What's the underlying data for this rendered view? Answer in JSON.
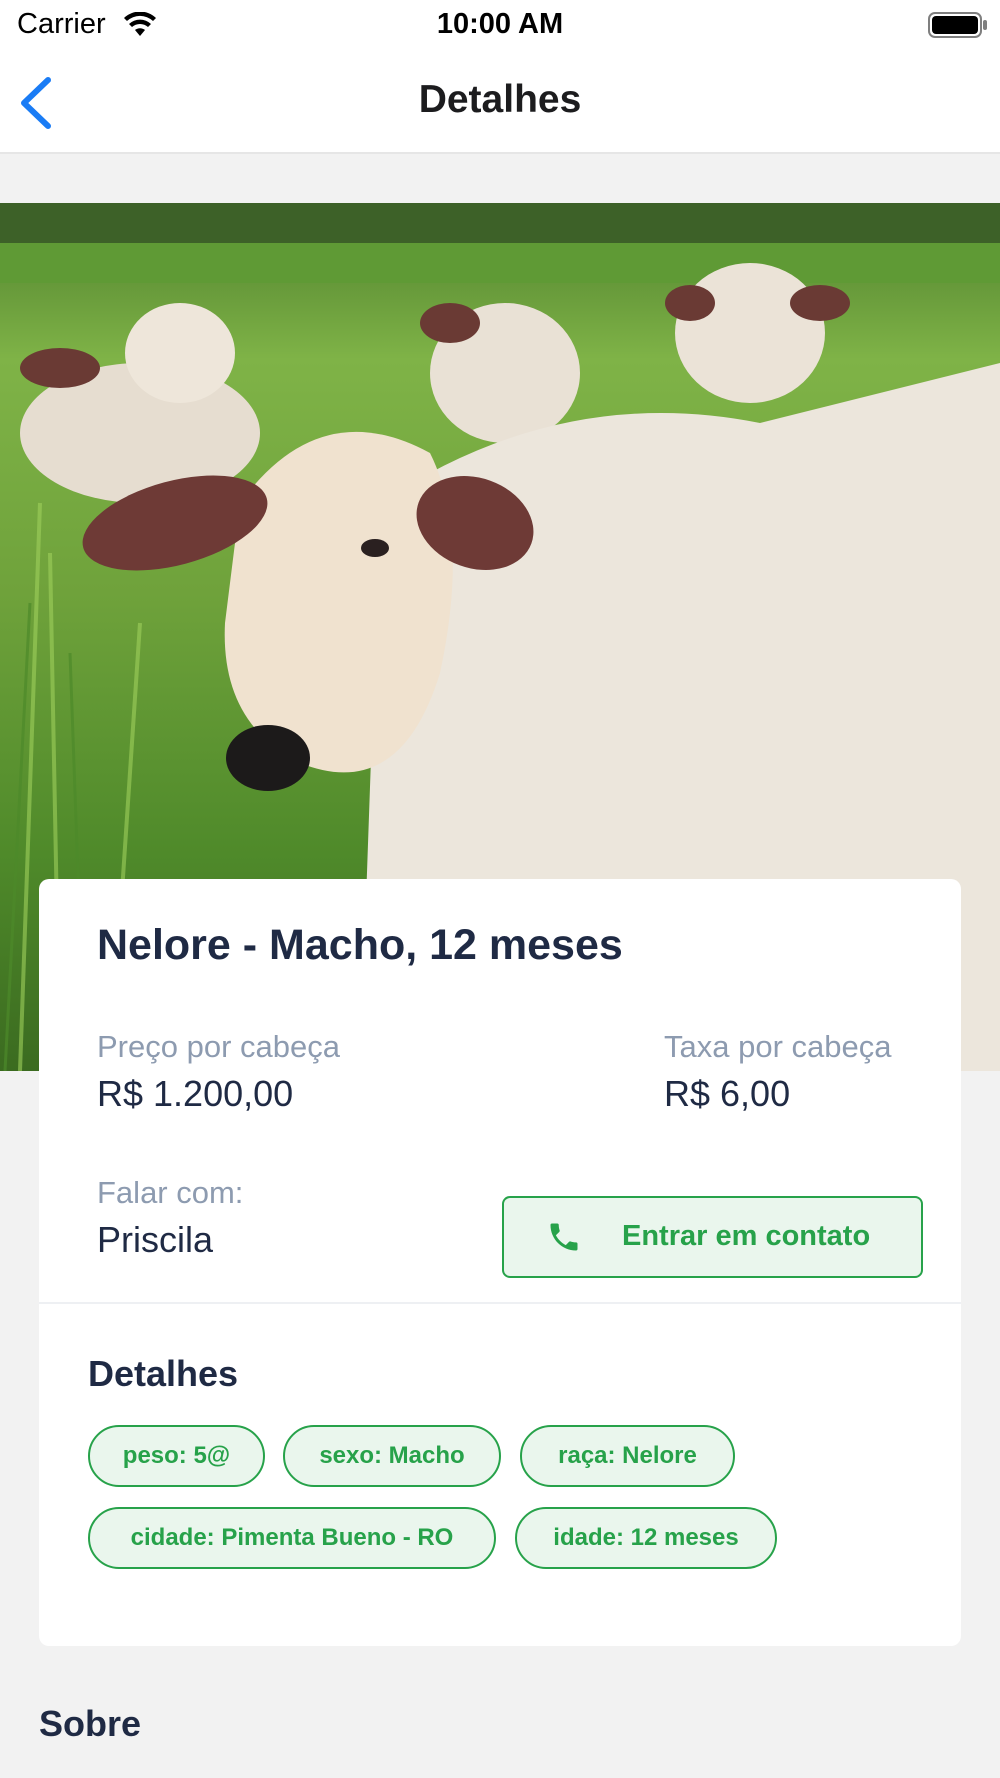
{
  "status_bar": {
    "carrier": "Carrier",
    "time": "10:00 AM"
  },
  "nav": {
    "title": "Detalhes"
  },
  "listing": {
    "title": "Nelore - Macho, 12 meses",
    "price_label": "Preço por cabeça",
    "price_value": "R$ 1.200,00",
    "fee_label": "Taxa por cabeça",
    "fee_value": "R$ 6,00",
    "contact_label": "Falar com:",
    "contact_name": "Priscila",
    "contact_button": "Entrar em contato"
  },
  "details": {
    "title": "Detalhes",
    "chips": [
      "peso: 5@",
      "sexo: Macho",
      "raça: Nelore",
      "cidade: Pimenta Bueno - RO",
      "idade: 12 meses"
    ]
  },
  "about": {
    "title": "Sobre"
  },
  "colors": {
    "accent_green": "#27a24a",
    "chip_bg": "#eaf6ed",
    "back_blue": "#1a7cf5",
    "text_dark": "#1f2a44",
    "text_muted": "#8d9bb0"
  },
  "icons": {
    "wifi": "wifi-icon",
    "battery": "battery-icon",
    "back": "chevron-left-icon",
    "phone": "phone-icon"
  }
}
